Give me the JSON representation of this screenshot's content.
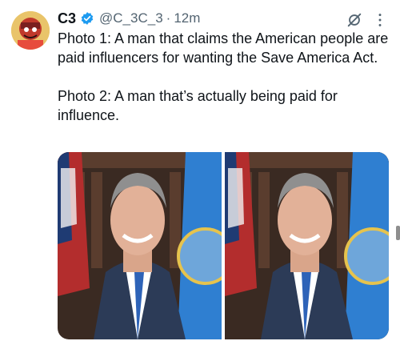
{
  "tweet": {
    "author_name": "C3",
    "handle": "@C_3C_3",
    "separator": "·",
    "time": "12m",
    "paragraphs": [
      "Photo 1: A man that claims the American people are paid influencers for wanting the Save America Act.",
      "Photo 2: A man that’s actually being paid for influence."
    ]
  },
  "icons": {
    "verified": "verified-badge-icon",
    "grok": "grok-icon",
    "more": "more-dots-icon"
  },
  "colors": {
    "verified_blue": "#1d9bf0",
    "text": "#0f1419",
    "secondary": "#536471"
  },
  "media": {
    "count": 2
  }
}
